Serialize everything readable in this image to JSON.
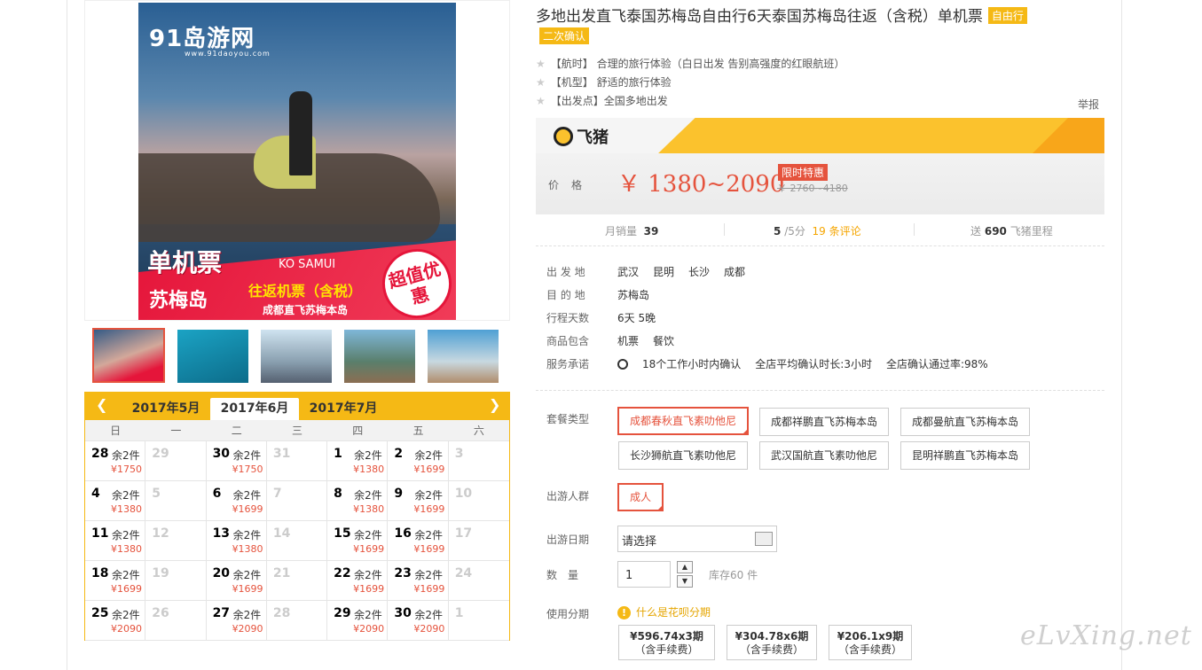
{
  "image": {
    "logo_text": "91岛游网",
    "logo_sub": "www.91daoyou.com",
    "banner_main": "单机票",
    "banner_en": "KO SAMUI",
    "banner_dest": "苏梅岛",
    "banner_round": "往返机票（含税）",
    "banner_route": "成都直飞苏梅本岛",
    "stamp": "超值优惠"
  },
  "calendar": {
    "prev_month": "2017年5月",
    "cur_month": "2017年6月",
    "next_month": "2017年7月",
    "weekdays": [
      "日",
      "一",
      "二",
      "三",
      "四",
      "五",
      "六"
    ],
    "rows": [
      [
        {
          "d": "28",
          "s": "余2件",
          "p": "¥1750"
        },
        {
          "d": "29",
          "gray": true
        },
        {
          "d": "30",
          "s": "余2件",
          "p": "¥1750"
        },
        {
          "d": "31",
          "gray": true
        },
        {
          "d": "1",
          "s": "余2件",
          "p": "¥1380"
        },
        {
          "d": "2",
          "s": "余2件",
          "p": "¥1699"
        },
        {
          "d": "3",
          "gray": true
        }
      ],
      [
        {
          "d": "4",
          "s": "余2件",
          "p": "¥1380"
        },
        {
          "d": "5",
          "gray": true
        },
        {
          "d": "6",
          "s": "余2件",
          "p": "¥1699"
        },
        {
          "d": "7",
          "gray": true
        },
        {
          "d": "8",
          "s": "余2件",
          "p": "¥1380"
        },
        {
          "d": "9",
          "s": "余2件",
          "p": "¥1699"
        },
        {
          "d": "10",
          "gray": true
        }
      ],
      [
        {
          "d": "11",
          "s": "余2件",
          "p": "¥1380"
        },
        {
          "d": "12",
          "gray": true
        },
        {
          "d": "13",
          "s": "余2件",
          "p": "¥1380"
        },
        {
          "d": "14",
          "gray": true
        },
        {
          "d": "15",
          "s": "余2件",
          "p": "¥1699"
        },
        {
          "d": "16",
          "s": "余2件",
          "p": "¥1699"
        },
        {
          "d": "17",
          "gray": true
        }
      ],
      [
        {
          "d": "18",
          "s": "余2件",
          "p": "¥1699"
        },
        {
          "d": "19",
          "gray": true
        },
        {
          "d": "20",
          "s": "余2件",
          "p": "¥1699"
        },
        {
          "d": "21",
          "gray": true
        },
        {
          "d": "22",
          "s": "余2件",
          "p": "¥1699"
        },
        {
          "d": "23",
          "s": "余2件",
          "p": "¥1699"
        },
        {
          "d": "24",
          "gray": true
        }
      ],
      [
        {
          "d": "25",
          "s": "余2件",
          "p": "¥2090"
        },
        {
          "d": "26",
          "gray": true
        },
        {
          "d": "27",
          "s": "余2件",
          "p": "¥2090"
        },
        {
          "d": "28",
          "gray": true
        },
        {
          "d": "29",
          "s": "余2件",
          "p": "¥2090"
        },
        {
          "d": "30",
          "s": "余2件",
          "p": "¥2090"
        },
        {
          "d": "1",
          "gray": true
        }
      ]
    ]
  },
  "product": {
    "title": "多地出发直飞泰国苏梅岛自由行6天泰国苏梅岛往返（含税）单机票",
    "tag1": "自由行",
    "tag2": "二次确认",
    "features": [
      "【航时】 合理的旅行体验（白日出发 告别高强度的红眼航班）",
      "【机型】 舒适的旅行体验",
      "【出发点】全国多地出发"
    ],
    "report": "举报",
    "fliggy": "飞猪",
    "price_label": "价格",
    "price": "￥ 1380~2090",
    "limit_tag": "限时特惠",
    "old_price": "￥ 2760~4180",
    "stats": {
      "sales_label": "月销量",
      "sales": "39",
      "rating": "5",
      "rating_suffix": "/5分",
      "reviews": "19 条评论",
      "mileage_pre": "送",
      "mileage": "690",
      "mileage_post": "飞猪里程"
    }
  },
  "info": {
    "depart_label": "出 发 地",
    "depart": [
      "武汉",
      "昆明",
      "长沙",
      "成都"
    ],
    "dest_label": "目 的 地",
    "dest": "苏梅岛",
    "days_label": "行程天数",
    "days": "6天 5晚",
    "include_label": "商品包含",
    "include": [
      "机票",
      "餐饮"
    ],
    "promise_label": "服务承诺",
    "promise": [
      "18个工作小时内确认",
      "全店平均确认时长:3小时",
      "全店确认通过率:98%"
    ]
  },
  "form": {
    "package_label": "套餐类型",
    "packages": [
      "成都春秋直飞素叻他尼",
      "成都祥鹏直飞苏梅本岛",
      "成都曼航直飞苏梅本岛",
      "长沙狮航直飞素叻他尼",
      "武汉国航直飞素叻他尼",
      "昆明祥鹏直飞苏梅本岛"
    ],
    "people_label": "出游人群",
    "people": "成人",
    "date_label": "出游日期",
    "date_placeholder": "请选择",
    "qty_label": "数　量",
    "qty": "1",
    "stock": "库存60 件",
    "install_label": "使用分期",
    "huabei": "什么是花呗分期",
    "installments": [
      {
        "amt": "¥596.74x3期",
        "fee": "（含手续费）"
      },
      {
        "amt": "¥304.78x6期",
        "fee": "（含手续费）"
      },
      {
        "amt": "¥206.1x9期",
        "fee": "（含手续费）"
      }
    ]
  },
  "watermark": "eLvXing.net"
}
